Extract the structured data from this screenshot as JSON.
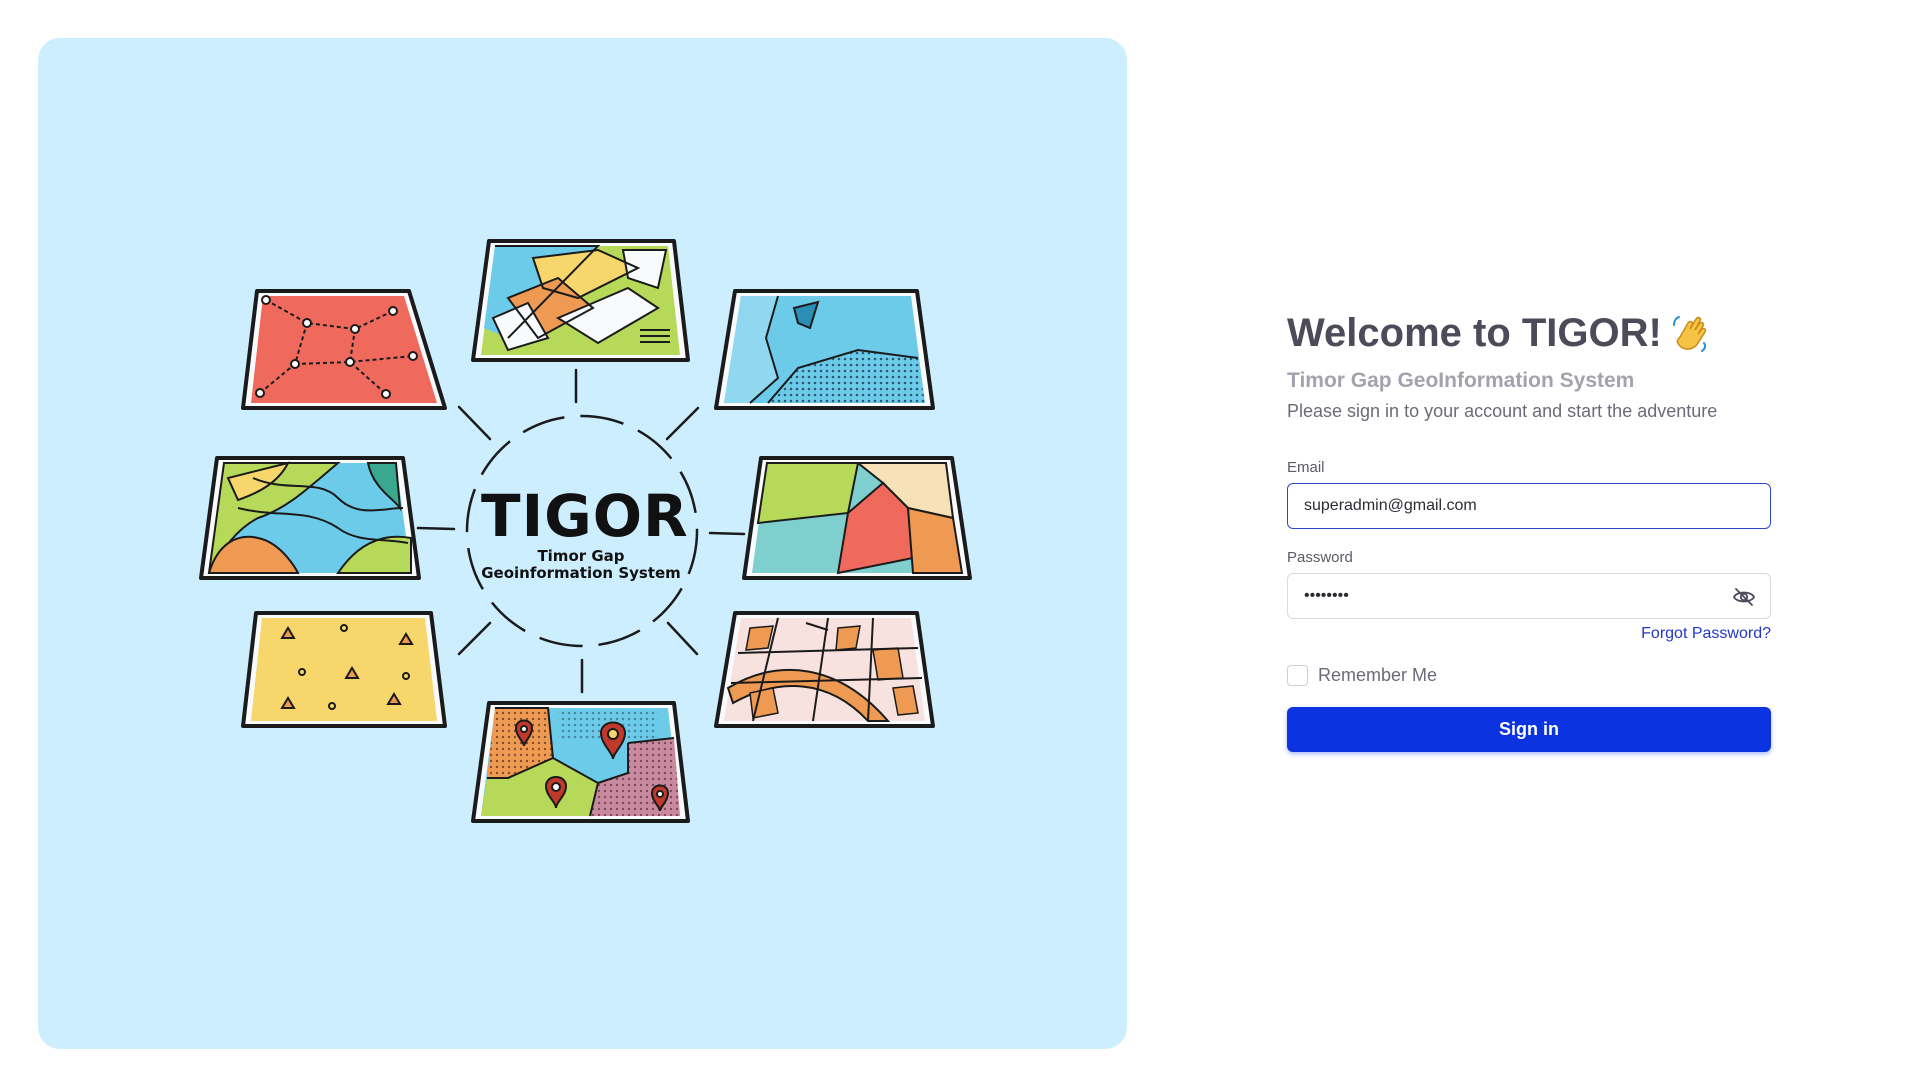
{
  "hero": {
    "title": "TIGOR",
    "subtitle_line1": "Timor Gap",
    "subtitle_line2": "Geoinformation System",
    "colors": {
      "panel_bg": "#cdeeff",
      "red_map": "#ef6a5c",
      "yellow_map": "#f7d66c",
      "blue_map": "#6dcbea",
      "green_map": "#b7d95a",
      "orange_map": "#ef9a52",
      "pink_map": "#f7e2df"
    },
    "map_icons": [
      "network-map-icon",
      "plots-map-icon",
      "coast-map-icon",
      "contour-map-icon",
      "regions-map-icon",
      "terrain-map-icon",
      "pins-map-icon",
      "streets-map-icon"
    ]
  },
  "login": {
    "title": "Welcome to TIGOR!",
    "title_icon": "waving-hand-icon",
    "system_name": "Timor Gap GeoInformation System",
    "tagline": "Please sign in to your account and start the adventure",
    "email_label": "Email",
    "email_value": "superadmin@gmail.com",
    "password_label": "Password",
    "password_value": "••••••••",
    "password_toggle_icon": "eye-off-icon",
    "forgot_password": "Forgot Password?",
    "remember_me": "Remember Me",
    "remember_checked": false,
    "submit": "Sign in",
    "colors": {
      "primary": "#0b33e0",
      "link": "#2336c8",
      "heading": "#4b4b5a",
      "muted": "#a2a3ae"
    }
  }
}
